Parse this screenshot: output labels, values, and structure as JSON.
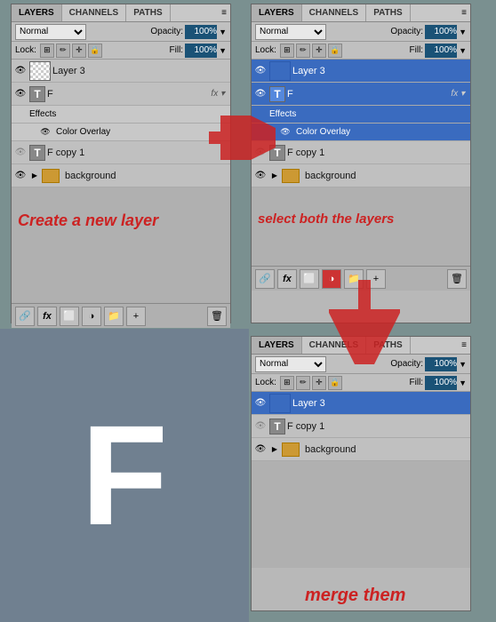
{
  "panels": {
    "top_left": {
      "tabs": [
        "LAYERS",
        "CHANNELS",
        "PATHS"
      ],
      "active_tab": "LAYERS",
      "blend_mode": "Normal",
      "opacity_label": "Opacity:",
      "opacity_value": "100%",
      "lock_label": "Lock:",
      "fill_label": "Fill:",
      "fill_value": "100%",
      "layers": [
        {
          "id": "layer3",
          "name": "Layer 3",
          "type": "normal",
          "visible": true,
          "selected": false
        },
        {
          "id": "f_text",
          "name": "F",
          "type": "text",
          "visible": true,
          "selected": false,
          "has_fx": true,
          "fx_label": "fx",
          "effects_label": "Effects",
          "sub_effect": "Color Overlay"
        },
        {
          "id": "f_copy1",
          "name": "F copy 1",
          "type": "text",
          "visible": false,
          "selected": false
        },
        {
          "id": "background",
          "name": "background",
          "type": "folder",
          "visible": true,
          "selected": false
        }
      ],
      "footer_icons": [
        "link",
        "fx",
        "mask",
        "gradient",
        "folder",
        "trash"
      ]
    },
    "top_right": {
      "tabs": [
        "LAYERS",
        "CHANNELS",
        "PATHS"
      ],
      "active_tab": "LAYERS",
      "blend_mode": "Normal",
      "opacity_label": "Opacity:",
      "opacity_value": "100%",
      "lock_label": "Lock:",
      "fill_label": "Fill:",
      "fill_value": "100%",
      "layers": [
        {
          "id": "layer3",
          "name": "Layer 3",
          "type": "normal",
          "visible": true,
          "selected": true
        },
        {
          "id": "f_text",
          "name": "F",
          "type": "text",
          "visible": true,
          "selected": true,
          "has_fx": true,
          "fx_label": "fx",
          "effects_label": "Effects",
          "sub_effect": "Color Overlay"
        },
        {
          "id": "f_copy1",
          "name": "F copy 1",
          "type": "text",
          "visible": false,
          "selected": false
        },
        {
          "id": "background",
          "name": "background",
          "type": "folder",
          "visible": true,
          "selected": false
        }
      ],
      "footer_icons": [
        "link",
        "fx",
        "mask",
        "gradient",
        "folder",
        "trash"
      ]
    },
    "bottom_right": {
      "tabs": [
        "LAYERS",
        "CHANNELS",
        "PATHS"
      ],
      "active_tab": "LAYERS",
      "blend_mode": "Normal",
      "opacity_label": "Opacity:",
      "opacity_value": "100%",
      "lock_label": "Lock:",
      "fill_label": "Fill:",
      "fill_value": "100%",
      "layers": [
        {
          "id": "layer3",
          "name": "Layer 3",
          "type": "normal",
          "visible": true,
          "selected": true
        },
        {
          "id": "f_copy1",
          "name": "F copy 1",
          "type": "text",
          "visible": false,
          "selected": false
        },
        {
          "id": "background",
          "name": "background",
          "type": "folder",
          "visible": true,
          "selected": false
        }
      ]
    }
  },
  "instructions": {
    "top_left": "Create a new layer",
    "top_right": "select both the layers",
    "bottom_right": "merge them"
  },
  "icons": {
    "eye": "👁",
    "link": "🔗",
    "fx": "ƒx",
    "text_t": "T",
    "menu": "≡",
    "trash": "🗑",
    "folder": "📁",
    "arrow_right": "▶",
    "collapse": "▶"
  }
}
